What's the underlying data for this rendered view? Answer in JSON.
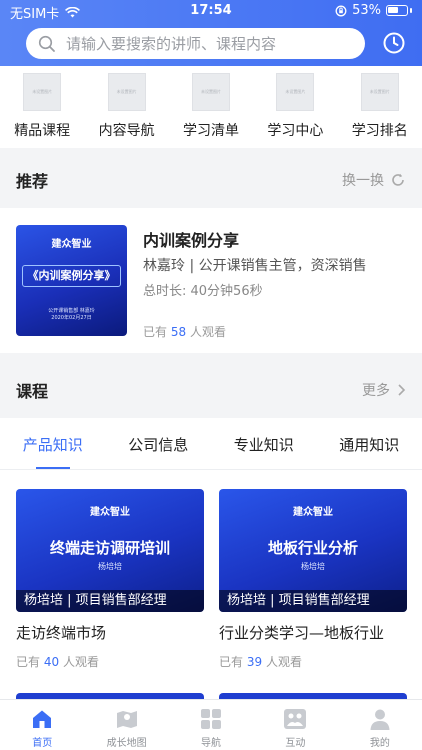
{
  "status_bar": {
    "carrier": "无SIM卡",
    "time": "17:54",
    "battery": "53%"
  },
  "search": {
    "placeholder": "请输入要搜索的讲师、课程内容"
  },
  "quick_nav": [
    {
      "label": "精品课程",
      "img_text": "未设置图片"
    },
    {
      "label": "内容导航",
      "img_text": "未设置图片"
    },
    {
      "label": "学习清单",
      "img_text": "未设置图片"
    },
    {
      "label": "学习中心",
      "img_text": "未设置图片"
    },
    {
      "label": "学习排名",
      "img_text": "未设置图片"
    }
  ],
  "recommend": {
    "section_title": "推荐",
    "refresh_label": "换一换",
    "item": {
      "title": "内训案例分享",
      "teacher": "林嘉玲 | 公开课销售主管，资深销售",
      "duration": "总时长: 40分钟56秒",
      "views_prefix": "已有",
      "views_count": "58",
      "views_suffix": "人观看",
      "poster_brand": "建众智业",
      "poster_title": "《内训案例分享》",
      "poster_meta_1": "公开课销售部  林嘉玲",
      "poster_meta_2": "2020年02月27日"
    }
  },
  "courses": {
    "section_title": "课程",
    "more_label": "更多",
    "tabs": [
      "产品知识",
      "公司信息",
      "专业知识",
      "通用知识"
    ],
    "items": [
      {
        "brand": "建众智业",
        "poster_title": "终端走访调研培训",
        "poster_teacher": "杨培培",
        "overlay": "杨培培 | 项目销售部经理",
        "name": "走访终端市场",
        "views_prefix": "已有",
        "views_count": "40",
        "views_suffix": "人观看"
      },
      {
        "brand": "建众智业",
        "poster_title": "地板行业分析",
        "poster_teacher": "杨培培",
        "overlay": "杨培培 | 项目销售部经理",
        "name": "行业分类学习—地板行业",
        "views_prefix": "已有",
        "views_count": "39",
        "views_suffix": "人观看"
      }
    ]
  },
  "tabbar": [
    {
      "label": "首页",
      "icon": "home-icon"
    },
    {
      "label": "成长地图",
      "icon": "map-icon"
    },
    {
      "label": "导航",
      "icon": "grid-icon"
    },
    {
      "label": "互动",
      "icon": "people-icon"
    },
    {
      "label": "我的",
      "icon": "user-icon"
    }
  ],
  "colors": {
    "accent": "#3b6ef5",
    "header": "#4a78f4"
  }
}
